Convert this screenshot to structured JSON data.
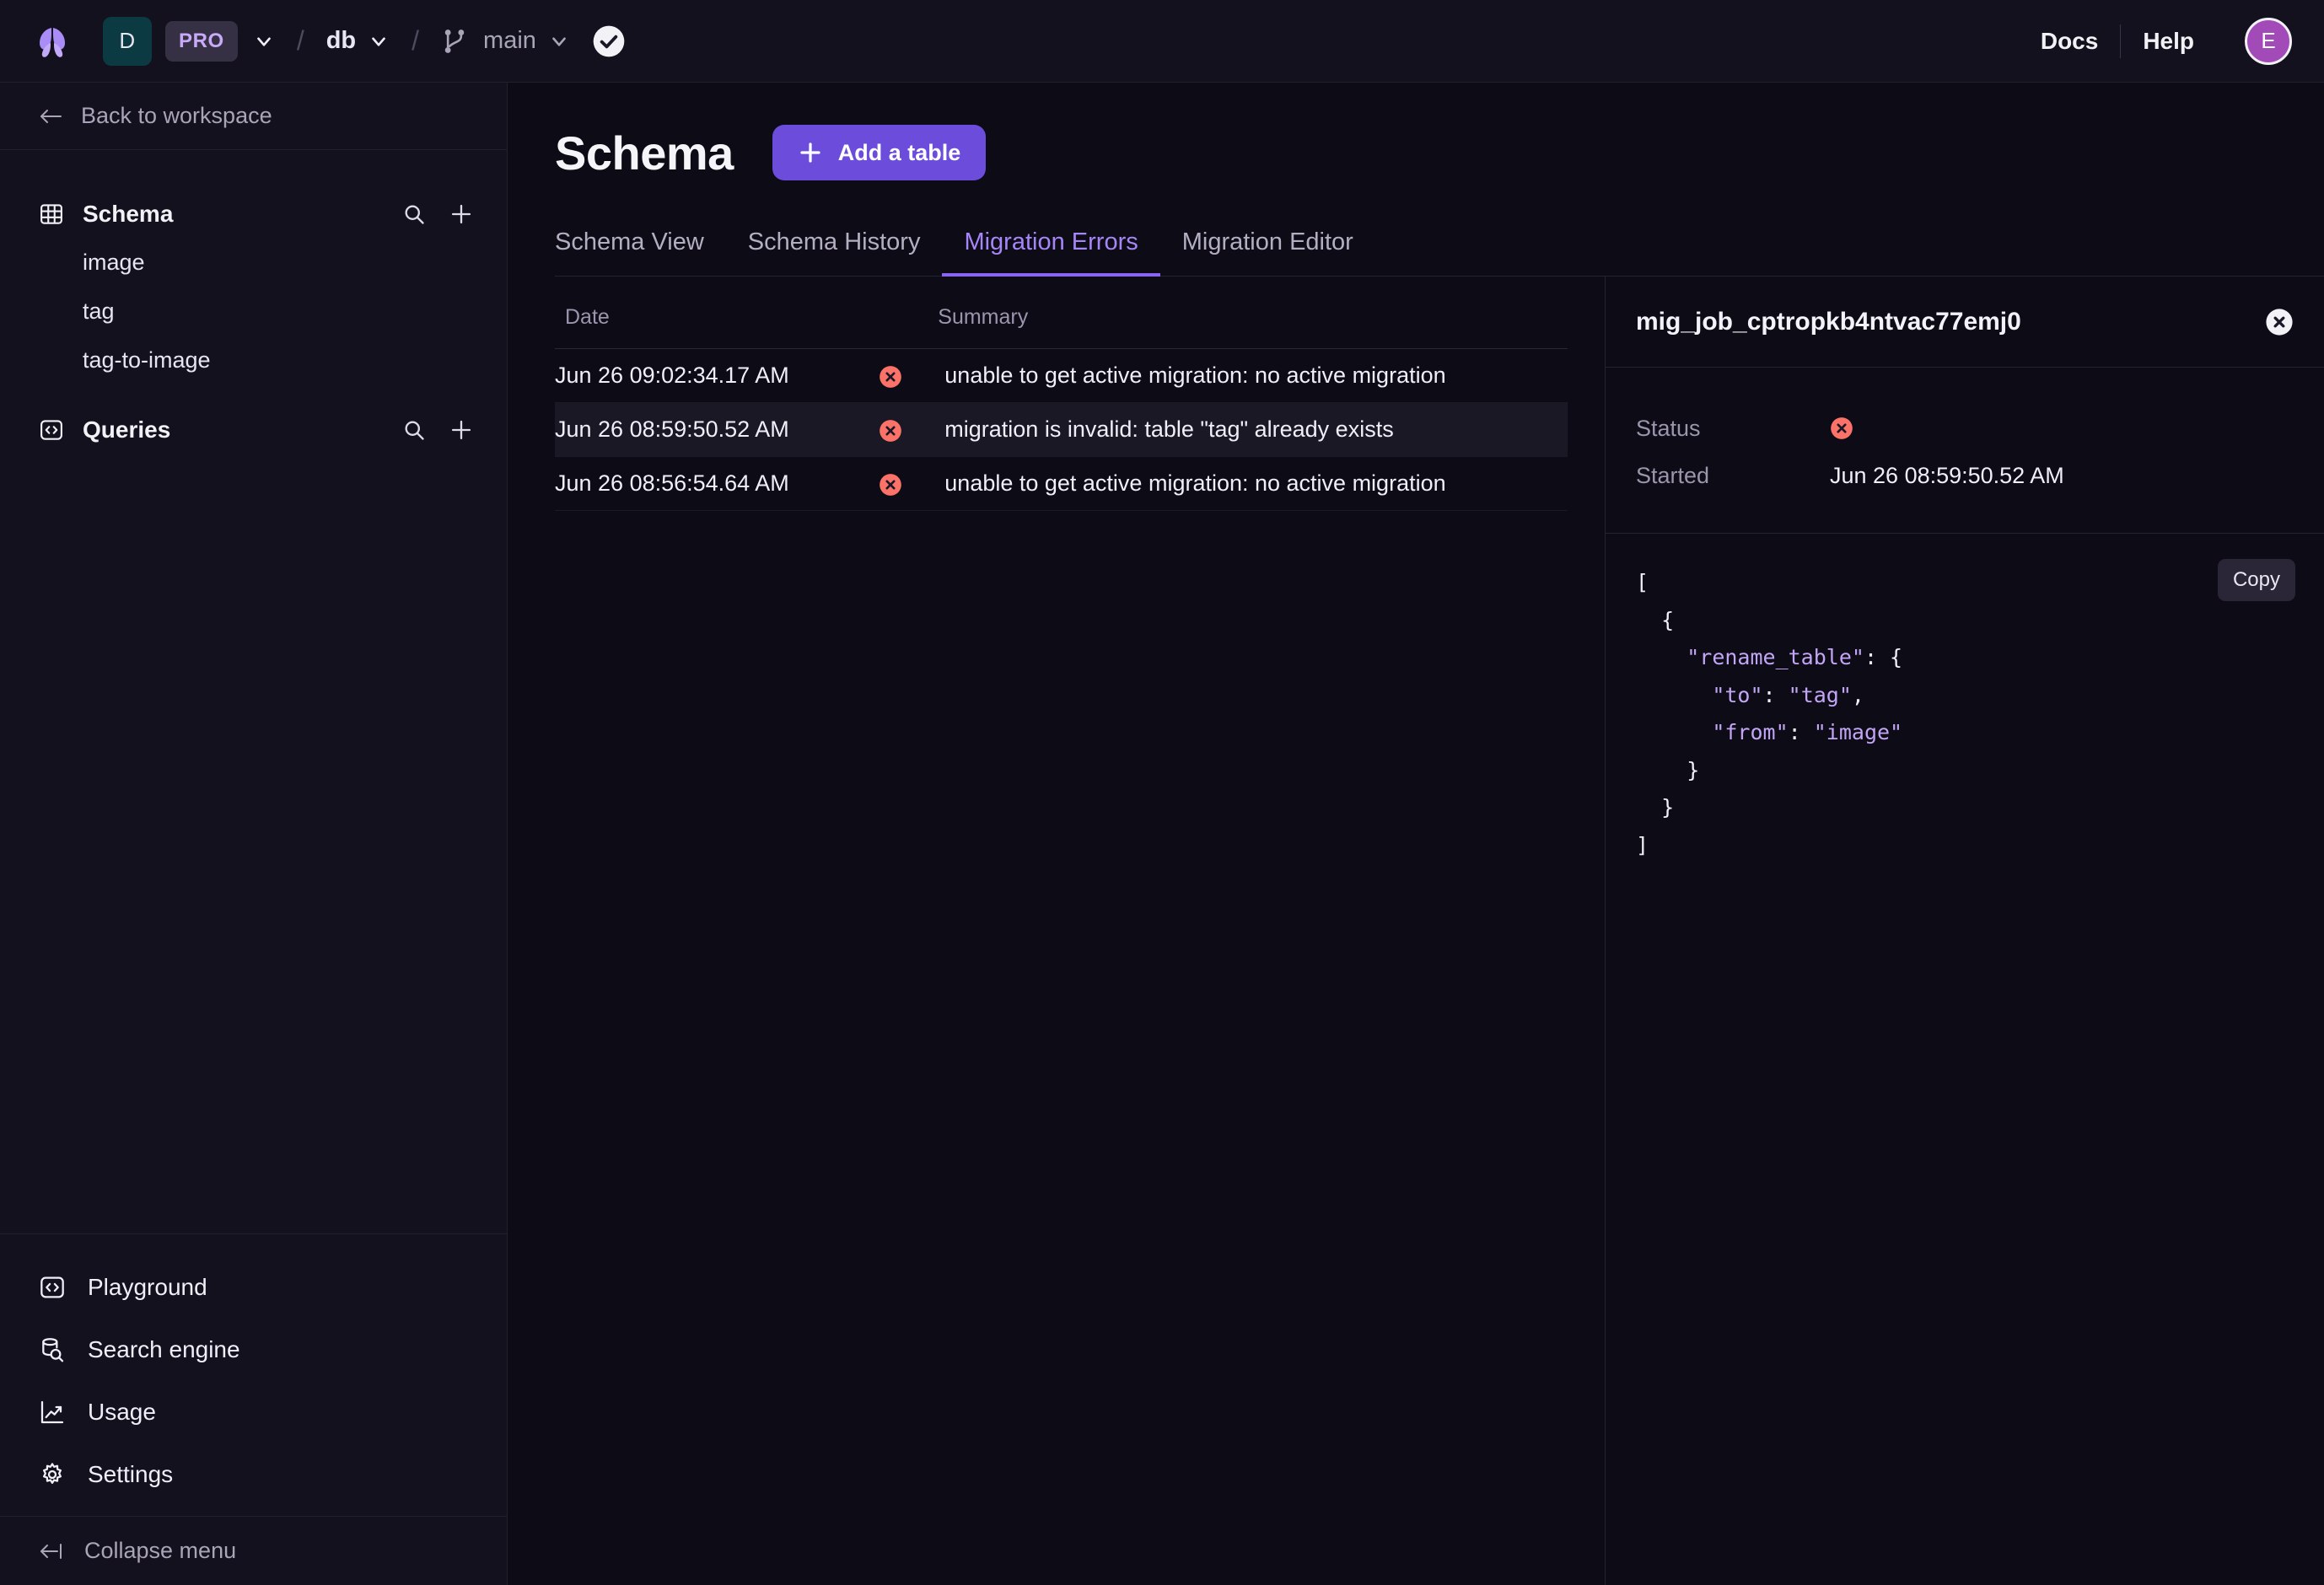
{
  "topbar": {
    "logo_icon": "butterfly-logo",
    "workspace_badge": "D",
    "plan_badge": "PRO",
    "database_name": "db",
    "branch_name": "main",
    "separator": "/",
    "docs_label": "Docs",
    "help_label": "Help",
    "avatar_initial": "E",
    "status_icon": "check-circle-icon"
  },
  "sidebar": {
    "back_label": "Back to workspace",
    "groups": [
      {
        "label": "Schema",
        "icon": "table-grid-icon",
        "items": [
          {
            "label": "image"
          },
          {
            "label": "tag"
          },
          {
            "label": "tag-to-image"
          }
        ]
      },
      {
        "label": "Queries",
        "icon": "code-brackets-icon",
        "items": []
      }
    ],
    "bottom_items": [
      {
        "label": "Playground",
        "icon": "code-brackets-icon"
      },
      {
        "label": "Search engine",
        "icon": "database-search-icon"
      },
      {
        "label": "Usage",
        "icon": "line-chart-icon"
      },
      {
        "label": "Settings",
        "icon": "gear-icon"
      }
    ],
    "collapse_label": "Collapse menu"
  },
  "main": {
    "page_title": "Schema",
    "add_table_label": "Add a table",
    "tabs": [
      {
        "label": "Schema View",
        "active": false
      },
      {
        "label": "Schema History",
        "active": false
      },
      {
        "label": "Migration Errors",
        "active": true
      },
      {
        "label": "Migration Editor",
        "active": false
      }
    ],
    "table": {
      "columns": [
        "Date",
        "Summary"
      ],
      "rows": [
        {
          "date": "Jun 26 09:02:34.17 AM",
          "status_icon": "error-circle-icon",
          "summary": "unable to get active migration: no active migration",
          "selected": false
        },
        {
          "date": "Jun 26 08:59:50.52 AM",
          "status_icon": "error-circle-icon",
          "summary": "migration is invalid: table \"tag\" already exists",
          "selected": true
        },
        {
          "date": "Jun 26 08:56:54.64 AM",
          "status_icon": "error-circle-icon",
          "summary": "unable to get active migration: no active migration",
          "selected": false
        }
      ]
    }
  },
  "detail": {
    "title": "mig_job_cptropkb4ntvac77emj0",
    "close_icon": "close-circle-icon",
    "status_label": "Status",
    "status_icon": "error-circle-icon",
    "started_label": "Started",
    "started_value": "Jun 26 08:59:50.52 AM",
    "copy_label": "Copy",
    "code": {
      "l0": "[",
      "l1": "  {",
      "l2_key": "\"rename_table\"",
      "l2_rest": ": {",
      "l3_key": "\"to\"",
      "l3_val": "\"tag\"",
      "l4_key": "\"from\"",
      "l4_val": "\"image\"",
      "l5": "    }",
      "l6": "  }",
      "l7": "]"
    }
  },
  "colors": {
    "accent_purple": "#6c4ddb",
    "tab_active": "#a685f7",
    "error_red": "#fa7268",
    "badge_teal": "#0c3a42",
    "sidebar_bg": "#13111d",
    "main_bg": "#0d0b16"
  }
}
